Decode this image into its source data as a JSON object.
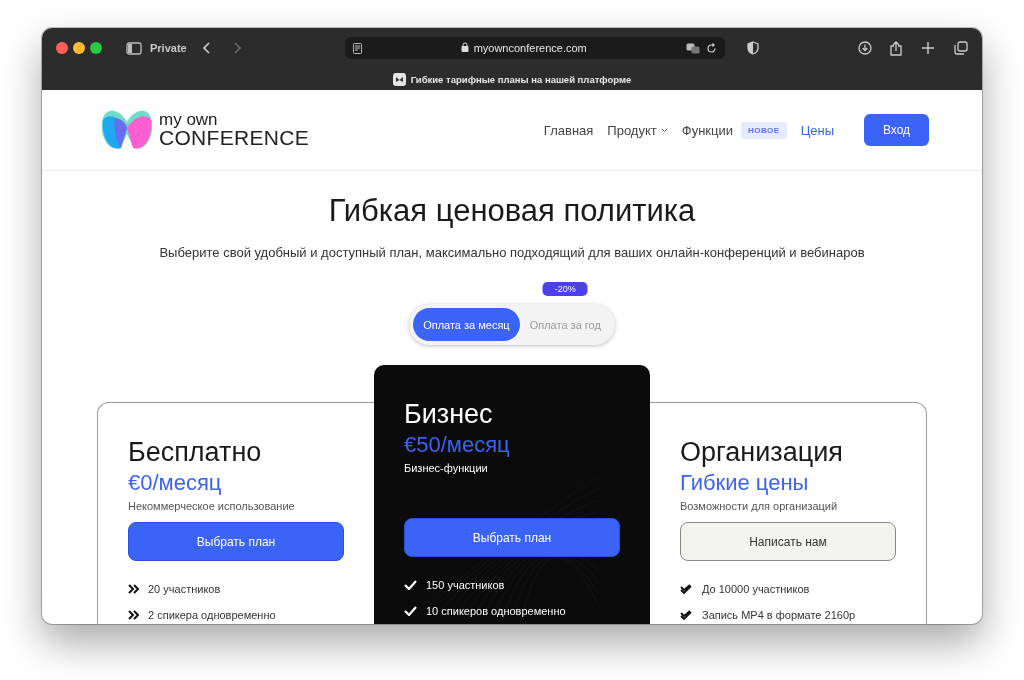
{
  "browser": {
    "mode": "Private",
    "url": "myownconference.com",
    "tab_title": "Гибкие тарифные планы на нашей платформе"
  },
  "logo": {
    "line1": "my own",
    "line2": "CONFERENCE"
  },
  "nav": [
    {
      "label": "Главная",
      "selected": false,
      "has_menu": false
    },
    {
      "label": "Продукт",
      "selected": false,
      "has_menu": true
    },
    {
      "label": "Функции",
      "selected": false,
      "has_menu": false,
      "badge": "НОВОЕ"
    },
    {
      "label": "Цены",
      "selected": true,
      "has_menu": false
    }
  ],
  "login_button": "Вход",
  "heading": "Гибкая ценовая политика",
  "subheading": "Выберите свой удобный и доступный план, максимально подходящий для ваших онлайн-конференций и вебинаров",
  "billing_toggle": [
    {
      "label": "Оплата за месяц",
      "selected": true
    },
    {
      "label": "Оплата за год",
      "selected": false,
      "badge": "-20%"
    }
  ],
  "plans": [
    {
      "kind": "basic",
      "name": "Бесплатно",
      "price": "€0/месяц",
      "note": "Некоммерческое использование",
      "button": "Выбрать план",
      "features": [
        "20 участников",
        "2 спикера одновременно"
      ]
    },
    {
      "kind": "featured",
      "name": "Бизнес",
      "price": "€50/месяц",
      "note": "Бизнес-функции",
      "button": "Выбрать план",
      "features": [
        "150 участников",
        "10 спикеров одновременно"
      ]
    },
    {
      "kind": "contact",
      "name": "Организация",
      "price": "Гибкие цены",
      "note": "Возможности для организаций",
      "button": "Написать нам",
      "features": [
        "До 10000 участников",
        "Запись MP4 в формате 2160p"
      ]
    }
  ]
}
